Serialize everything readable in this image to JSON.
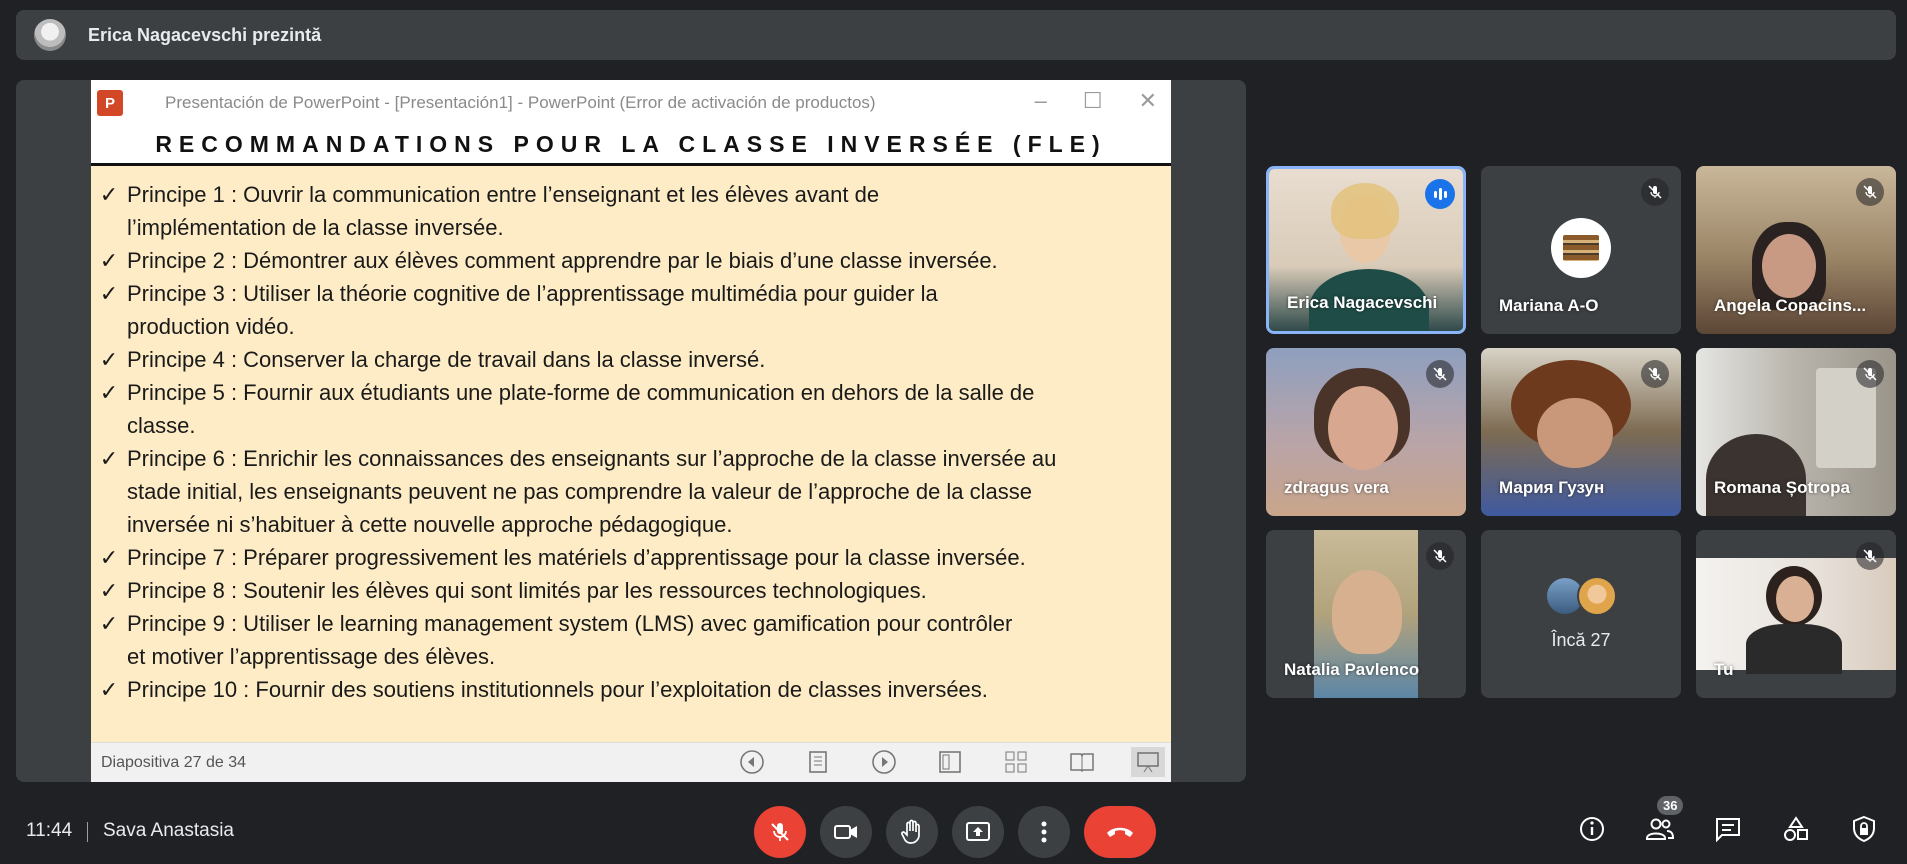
{
  "presenter_bar": {
    "text": "Erica Nagacevschi prezintă"
  },
  "ppt": {
    "logo": "P",
    "window_title": "Presentación de PowerPoint - [Presentación1] - PowerPoint (Error de activación de productos)",
    "heading": "RECOMMANDATIONS POUR LA CLASSE INVERSÉE (FLE)",
    "bullets": [
      {
        "lines": [
          "Principe  1  :  Ouvrir  la  communication  entre  l’enseignant  et  les  élèves  avant  de",
          "l’implémentation de la classe inversée."
        ]
      },
      {
        "lines": [
          "Principe 2 : Démontrer aux élèves comment apprendre par le biais d’une classe inversée."
        ]
      },
      {
        "lines": [
          "Principe  3  :  Utiliser  la  théorie  cognitive  de  l’apprentissage  multimédia  pour  guider  la",
          "production vidéo."
        ]
      },
      {
        "lines": [
          "Principe 4 : Conserver la charge de travail dans la classe inversé."
        ]
      },
      {
        "lines": [
          "Principe 5 : Fournir aux étudiants une plate-forme de communication en dehors de la salle de",
          "classe."
        ]
      },
      {
        "lines": [
          "Principe 6 : Enrichir les connaissances des enseignants sur l’approche de la classe inversée au",
          "stade initial, les enseignants peuvent ne pas comprendre la valeur de l’approche de la classe",
          "inversée ni s’habituer à cette nouvelle approche pédagogique."
        ]
      },
      {
        "lines": [
          "Principe 7 : Préparer progressivement les matériels d’apprentissage pour la classe inversée."
        ]
      },
      {
        "lines": [
          "Principe 8 : Soutenir les élèves qui sont limités par les ressources technologiques."
        ]
      },
      {
        "lines": [
          "Principe 9 : Utiliser le learning management system (LMS) avec gamification pour contrôler",
          "et motiver l’apprentissage des élèves."
        ]
      },
      {
        "lines": [
          "Principe 10 : Fournir des soutiens institutionnels pour l’exploitation de classes inversées."
        ]
      }
    ],
    "slide_counter": "Diapositiva 27 de 34"
  },
  "participants": [
    {
      "name": "Erica Nagacevschi",
      "state": "speaking"
    },
    {
      "name": "Mariana A-O",
      "state": "muted"
    },
    {
      "name": "Angela Copacins...",
      "state": "muted"
    },
    {
      "name": "zdragus vera",
      "state": "muted"
    },
    {
      "name": "Мария Гузун",
      "state": "muted"
    },
    {
      "name": "Romana Șotropa",
      "state": "muted"
    },
    {
      "name": "Natalia Pavlenco",
      "state": "muted"
    },
    {
      "name": "Încă 27",
      "state": "more"
    },
    {
      "name": "Tu",
      "state": "muted"
    }
  ],
  "bottom_bar": {
    "time": "11:44",
    "meeting_name": "Sava Anastasia",
    "participants_count": "36"
  },
  "colors": {
    "accent_blue": "#1a73e8",
    "end_call_red": "#ea4335",
    "surface": "#3c4043",
    "background": "#202124"
  }
}
